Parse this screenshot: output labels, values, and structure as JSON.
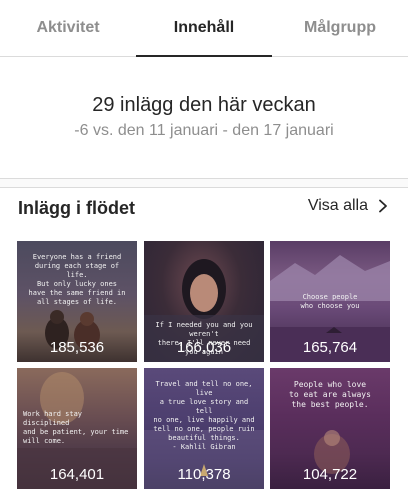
{
  "tabs": [
    {
      "label": "Aktivitet",
      "active": false
    },
    {
      "label": "Innehåll",
      "active": true
    },
    {
      "label": "Målgrupp",
      "active": false
    }
  ],
  "summary": {
    "title": "29 inlägg den här veckan",
    "subtitle": "-6 vs. den 11 januari - den 17 januari"
  },
  "feed": {
    "title": "Inlägg i flödet",
    "see_all": "Visa alla"
  },
  "posts": [
    {
      "count": "185,536",
      "quote": "Everyone has a friend\nduring each stage of life.\nBut only lucky ones\nhave the same friend in\nall stages of life."
    },
    {
      "count": "166,036",
      "quote": "If I needed you and you weren't\nthere, I'll never need you again"
    },
    {
      "count": "165,764",
      "quote": "Choose people\nwho choose you"
    },
    {
      "count": "164,401",
      "quote": "Work hard stay disciplined\nand be patient, your time\nwill come."
    },
    {
      "count": "110,378",
      "quote": "Travel and tell no one, live\na true love story and tell\nno one, live happily and\ntell no one, people ruin\nbeautiful things.\n- Kahlil Gibran"
    },
    {
      "count": "104,722",
      "quote": "People who love\nto eat are always\nthe best people."
    }
  ]
}
